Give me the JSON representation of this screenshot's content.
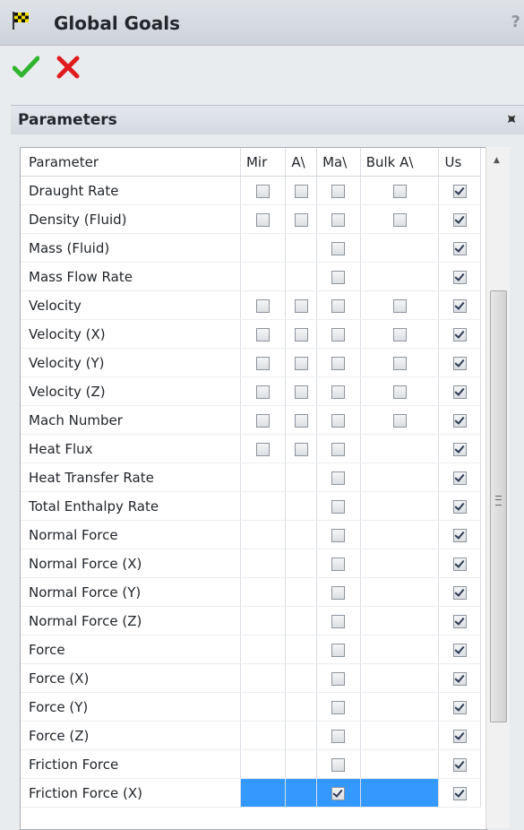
{
  "window": {
    "title": "Global Goals",
    "help": "?"
  },
  "group": {
    "title": "Parameters"
  },
  "table": {
    "headers": [
      "Parameter",
      "Mir",
      "A\\",
      "Ma\\",
      "Bulk A\\",
      "Us"
    ],
    "rows": [
      {
        "name": "Draught Rate",
        "min": "off",
        "av": "off",
        "max": "off",
        "bulk": "off",
        "use": "on"
      },
      {
        "name": "Density (Fluid)",
        "min": "off",
        "av": "off",
        "max": "off",
        "bulk": "off",
        "use": "on"
      },
      {
        "name": "Mass (Fluid)",
        "min": "none",
        "av": "none",
        "max": "off",
        "bulk": "none",
        "use": "on"
      },
      {
        "name": "Mass Flow Rate",
        "min": "none",
        "av": "none",
        "max": "off",
        "bulk": "none",
        "use": "on"
      },
      {
        "name": "Velocity",
        "min": "off",
        "av": "off",
        "max": "off",
        "bulk": "off",
        "use": "on"
      },
      {
        "name": "Velocity (X)",
        "min": "off",
        "av": "off",
        "max": "off",
        "bulk": "off",
        "use": "on"
      },
      {
        "name": "Velocity (Y)",
        "min": "off",
        "av": "off",
        "max": "off",
        "bulk": "off",
        "use": "on"
      },
      {
        "name": "Velocity (Z)",
        "min": "off",
        "av": "off",
        "max": "off",
        "bulk": "off",
        "use": "on"
      },
      {
        "name": "Mach Number",
        "min": "off",
        "av": "off",
        "max": "off",
        "bulk": "off",
        "use": "on"
      },
      {
        "name": "Heat Flux",
        "min": "off",
        "av": "off",
        "max": "off",
        "bulk": "none",
        "use": "on"
      },
      {
        "name": "Heat Transfer Rate",
        "min": "none",
        "av": "none",
        "max": "off",
        "bulk": "none",
        "use": "on"
      },
      {
        "name": "Total Enthalpy Rate",
        "min": "none",
        "av": "none",
        "max": "off",
        "bulk": "none",
        "use": "on"
      },
      {
        "name": "Normal Force",
        "min": "none",
        "av": "none",
        "max": "off",
        "bulk": "none",
        "use": "on"
      },
      {
        "name": "Normal Force (X)",
        "min": "none",
        "av": "none",
        "max": "off",
        "bulk": "none",
        "use": "on"
      },
      {
        "name": "Normal Force (Y)",
        "min": "none",
        "av": "none",
        "max": "off",
        "bulk": "none",
        "use": "on"
      },
      {
        "name": "Normal Force (Z)",
        "min": "none",
        "av": "none",
        "max": "off",
        "bulk": "none",
        "use": "on"
      },
      {
        "name": "Force",
        "min": "none",
        "av": "none",
        "max": "off",
        "bulk": "none",
        "use": "on"
      },
      {
        "name": "Force (X)",
        "min": "none",
        "av": "none",
        "max": "off",
        "bulk": "none",
        "use": "on"
      },
      {
        "name": "Force (Y)",
        "min": "none",
        "av": "none",
        "max": "off",
        "bulk": "none",
        "use": "on"
      },
      {
        "name": "Force (Z)",
        "min": "none",
        "av": "none",
        "max": "off",
        "bulk": "none",
        "use": "on"
      },
      {
        "name": "Friction Force",
        "min": "none",
        "av": "none",
        "max": "off",
        "bulk": "none",
        "use": "on"
      },
      {
        "name": "Friction Force (X)",
        "min": "none",
        "av": "none",
        "max": "on",
        "bulk": "none",
        "use": "on",
        "selected": true
      }
    ]
  },
  "colors": {
    "selection": "#3399ff",
    "accept": "#2fb52f",
    "cancel": "#e01b1b"
  }
}
